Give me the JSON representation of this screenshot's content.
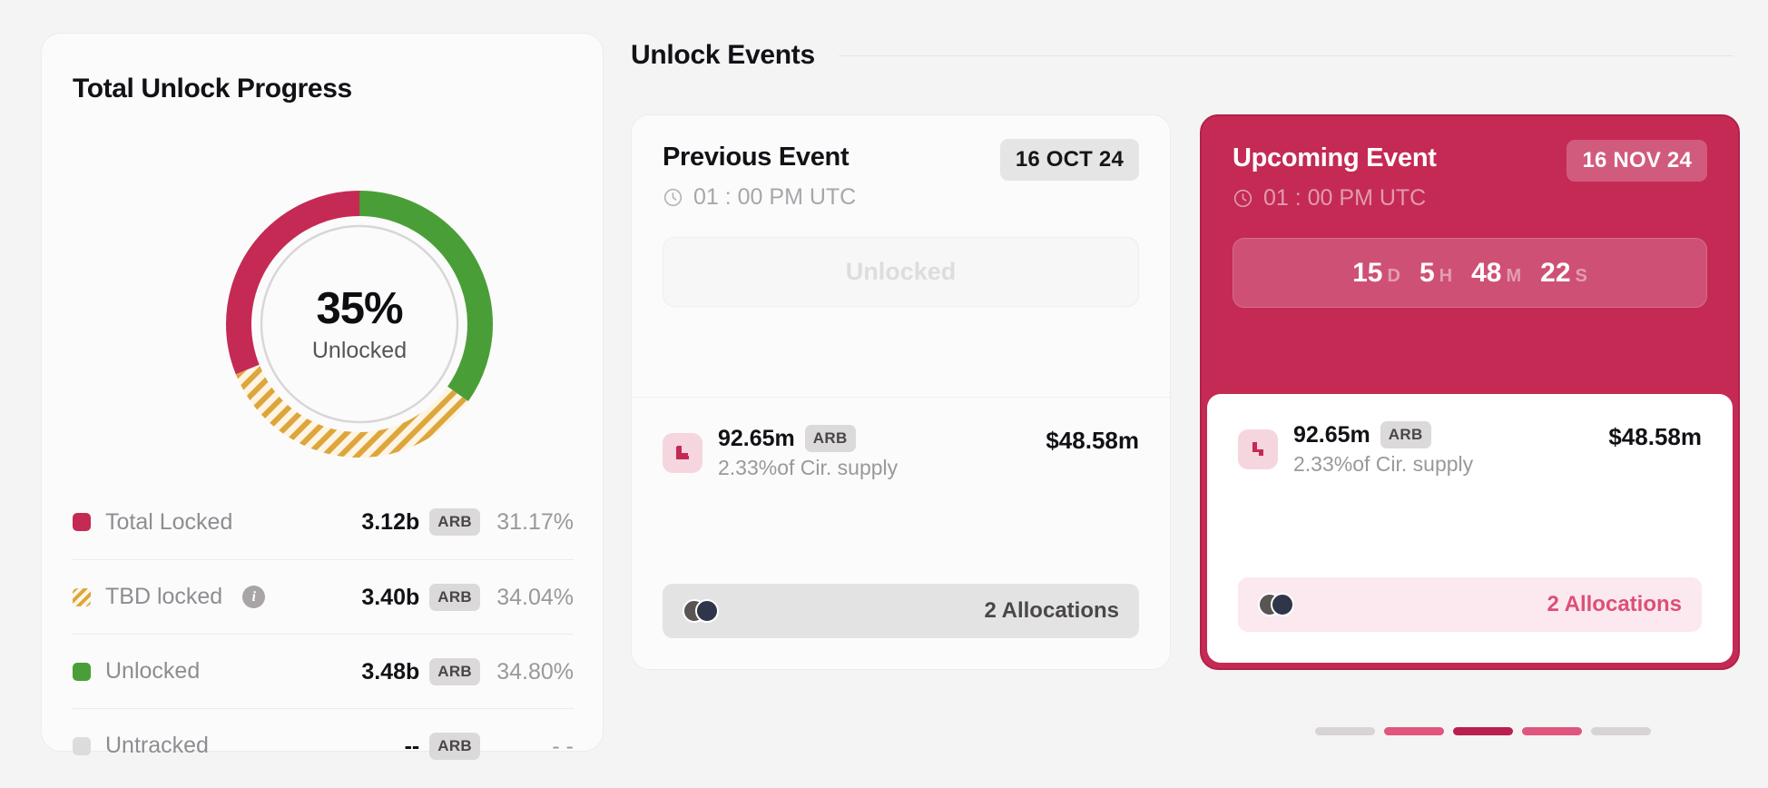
{
  "progress": {
    "title": "Total Unlock Progress",
    "donut_center_value": "35%",
    "donut_center_label": "Unlocked",
    "legend": [
      {
        "name": "total-locked",
        "label": "Total Locked",
        "swatch": "crimson-square-icon",
        "value": "3.12b",
        "token": "ARB",
        "percent": "31.17%",
        "has_info": false
      },
      {
        "name": "tbd-locked",
        "label": "TBD locked",
        "swatch": "gold-striped-square-icon",
        "value": "3.40b",
        "token": "ARB",
        "percent": "34.04%",
        "has_info": true,
        "info_icon": "info-icon"
      },
      {
        "name": "unlocked",
        "label": "Unlocked",
        "swatch": "green-square-icon",
        "value": "3.48b",
        "token": "ARB",
        "percent": "34.80%",
        "has_info": false
      },
      {
        "name": "untracked",
        "label": "Untracked",
        "swatch": "gray-square-icon",
        "value": "--",
        "token": "ARB",
        "percent": "- -",
        "has_info": false
      }
    ]
  },
  "events": {
    "section_title": "Unlock Events",
    "previous": {
      "title": "Previous Event",
      "date": "16 OCT 24",
      "clock_icon": "clock-icon",
      "time": "01 : 00 PM UTC",
      "status": "Unlocked",
      "allocation": {
        "icon": "unlock-block-icon",
        "amount": "92.65m",
        "token": "ARB",
        "subtitle": "2.33%of Cir. supply",
        "usd": "$48.58m"
      },
      "footer_count": "2 Allocations"
    },
    "upcoming": {
      "title": "Upcoming Event",
      "date": "16 NOV 24",
      "clock_icon": "clock-icon",
      "time": "01 : 00 PM UTC",
      "countdown": {
        "days": "15",
        "days_unit": "D",
        "hours": "5",
        "hours_unit": "H",
        "minutes": "48",
        "minutes_unit": "M",
        "seconds": "22",
        "seconds_unit": "S"
      },
      "allocation": {
        "icon": "unlock-block-icon",
        "amount": "92.65m",
        "token": "ARB",
        "subtitle": "2.33%of Cir. supply",
        "usd": "$48.58m"
      },
      "footer_count": "2 Allocations"
    },
    "pagination": [
      {
        "color": "#d8d4d5"
      },
      {
        "color": "#e0567d"
      },
      {
        "color": "#b9204f"
      },
      {
        "color": "#e0567d"
      },
      {
        "color": "#d8d4d5"
      }
    ]
  },
  "colors": {
    "locked": "#c42a54",
    "tbd": "#dca63a",
    "unlocked": "#4a9e37",
    "untracked": "#dcdcdc",
    "accent": "#c42a54"
  },
  "chart_data": {
    "type": "pie",
    "title": "Total Unlock Progress",
    "center_label": "35% Unlocked",
    "categories": [
      "Unlocked",
      "TBD locked",
      "Total Locked"
    ],
    "values": [
      34.8,
      34.04,
      31.17
    ],
    "units": "percent",
    "amounts": [
      "3.48b ARB",
      "3.40b ARB",
      "3.12b ARB"
    ],
    "colors": [
      "#4a9e37",
      "#dca63a",
      "#c42a54"
    ],
    "legend_position": "below",
    "grid": false,
    "start_angle_deg": 0,
    "direction": "clockwise"
  }
}
